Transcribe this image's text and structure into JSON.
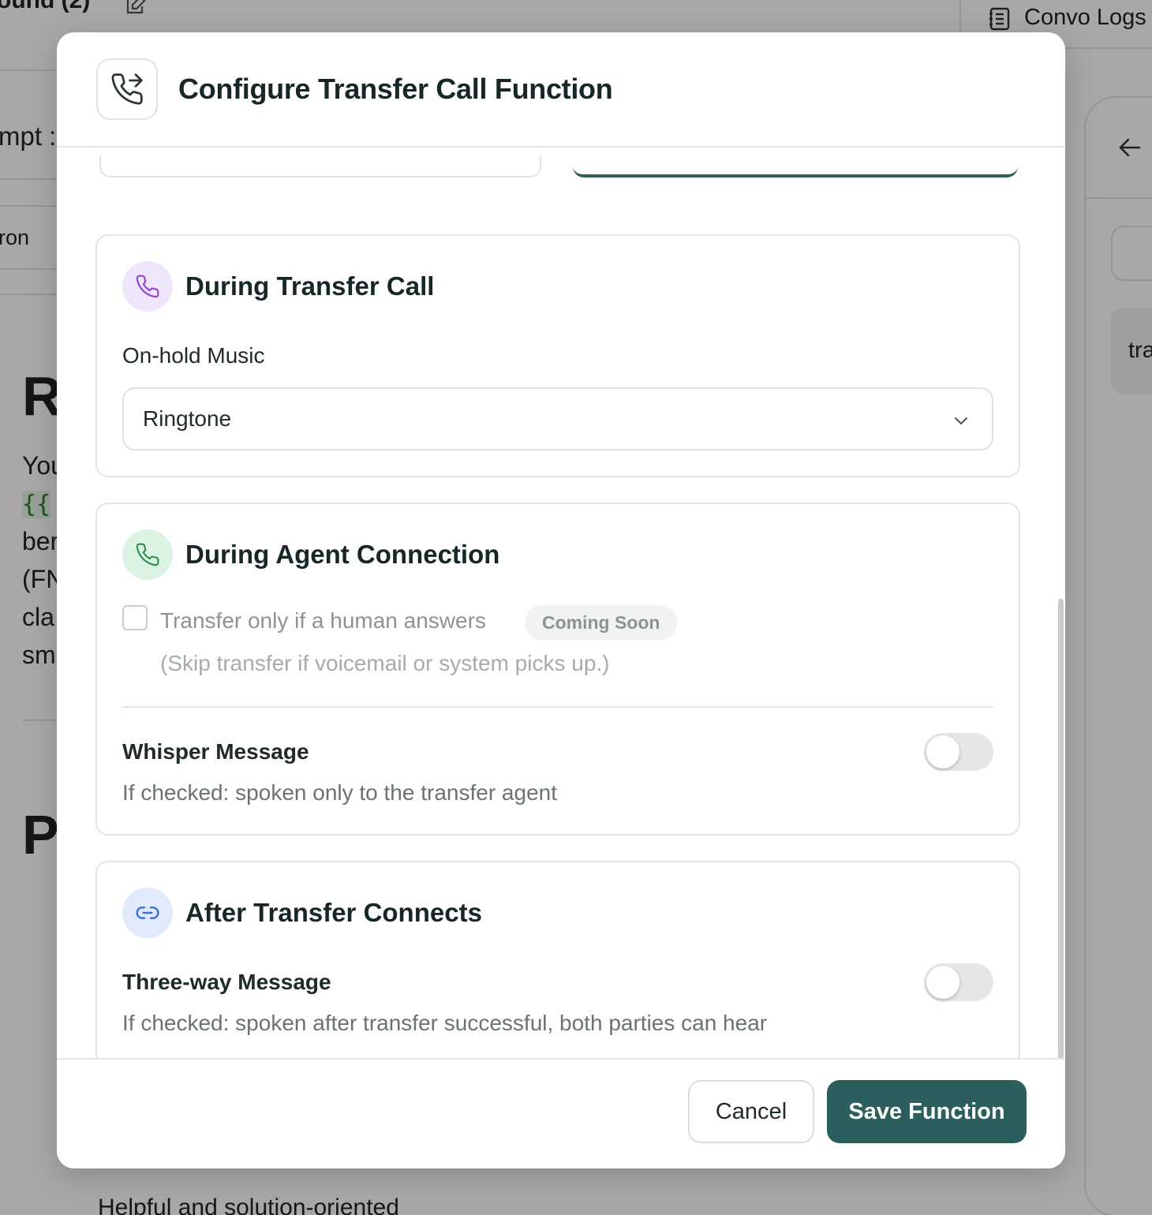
{
  "background": {
    "tab_label": "ound (2)",
    "convo_logs": "Convo Logs",
    "prompt_stub": "mpt :",
    "name_stub": "ron",
    "heading_r": "R",
    "heading_p": "P",
    "para_lines": [
      "You",
      "{{",
      "ber",
      "(FN",
      "cla",
      "sm"
    ],
    "right_text": "tra",
    "bottom_text": "Helpful and solution-oriented"
  },
  "modal": {
    "title": "Configure Transfer Call Function",
    "header_icon": "phone-forward-icon",
    "during_transfer": {
      "title": "During Transfer Call",
      "icon": "phone-icon",
      "onhold_label": "On-hold Music",
      "onhold_value": "Ringtone"
    },
    "during_agent": {
      "title": "During Agent Connection",
      "icon": "phone-icon",
      "checkbox_label": "Transfer only if a human answers",
      "badge": "Coming Soon",
      "checkbox_sub": "(Skip transfer if voicemail or system picks up.)",
      "checked": false,
      "whisper_title": "Whisper Message",
      "whisper_desc": "If checked: spoken only to the transfer agent",
      "whisper_on": false
    },
    "after_transfer": {
      "title": "After Transfer Connects",
      "icon": "link-icon",
      "threeway_title": "Three-way Message",
      "threeway_desc": "If checked: spoken after transfer successful, both parties can hear",
      "threeway_on": false
    },
    "footer": {
      "cancel": "Cancel",
      "save": "Save Function"
    }
  },
  "colors": {
    "primary": "#2b5e5c",
    "purple_icon": "#8e44d6",
    "green_icon": "#2f8f4e",
    "blue_icon": "#3d6fd6"
  }
}
